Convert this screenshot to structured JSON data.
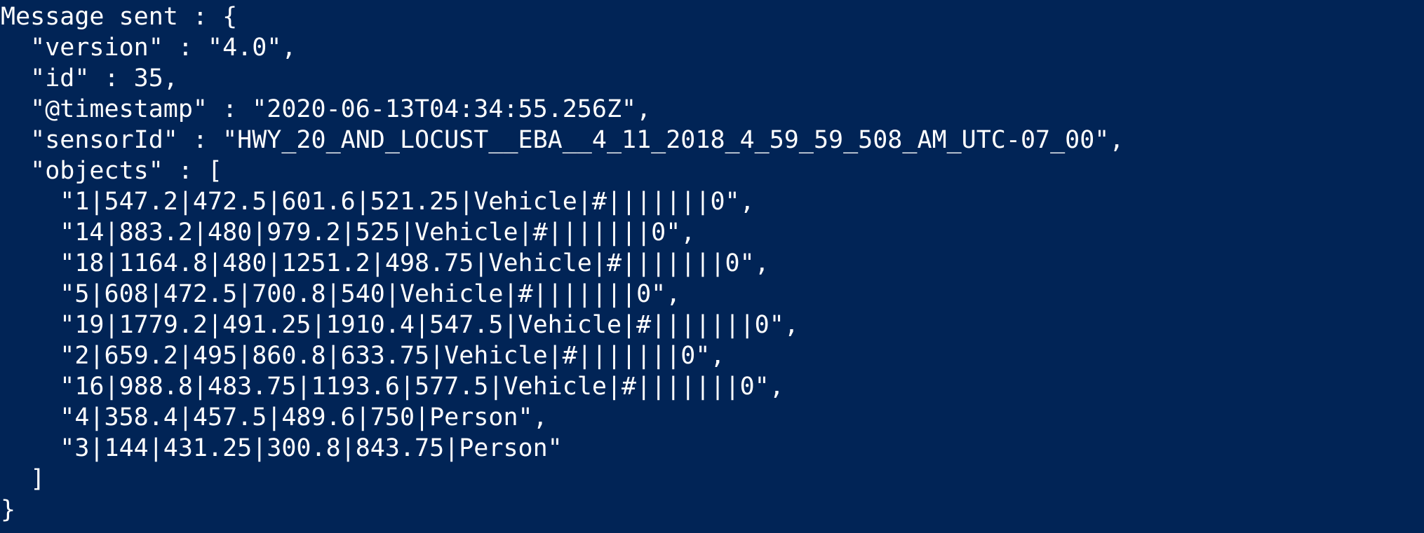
{
  "terminal": {
    "background": "#012456",
    "foreground": "#ffffff",
    "lines": [
      "Message sent : {",
      "  \"version\" : \"4.0\",",
      "  \"id\" : 35,",
      "  \"@timestamp\" : \"2020-06-13T04:34:55.256Z\",",
      "  \"sensorId\" : \"HWY_20_AND_LOCUST__EBA__4_11_2018_4_59_59_508_AM_UTC-07_00\",",
      "  \"objects\" : [",
      "    \"1|547.2|472.5|601.6|521.25|Vehicle|#|||||||0\",",
      "    \"14|883.2|480|979.2|525|Vehicle|#|||||||0\",",
      "    \"18|1164.8|480|1251.2|498.75|Vehicle|#|||||||0\",",
      "    \"5|608|472.5|700.8|540|Vehicle|#|||||||0\",",
      "    \"19|1779.2|491.25|1910.4|547.5|Vehicle|#|||||||0\",",
      "    \"2|659.2|495|860.8|633.75|Vehicle|#|||||||0\",",
      "    \"16|988.8|483.75|1193.6|577.5|Vehicle|#|||||||0\",",
      "    \"4|358.4|457.5|489.6|750|Person\",",
      "    \"3|144|431.25|300.8|843.75|Person\"",
      "  ]",
      "}"
    ]
  }
}
